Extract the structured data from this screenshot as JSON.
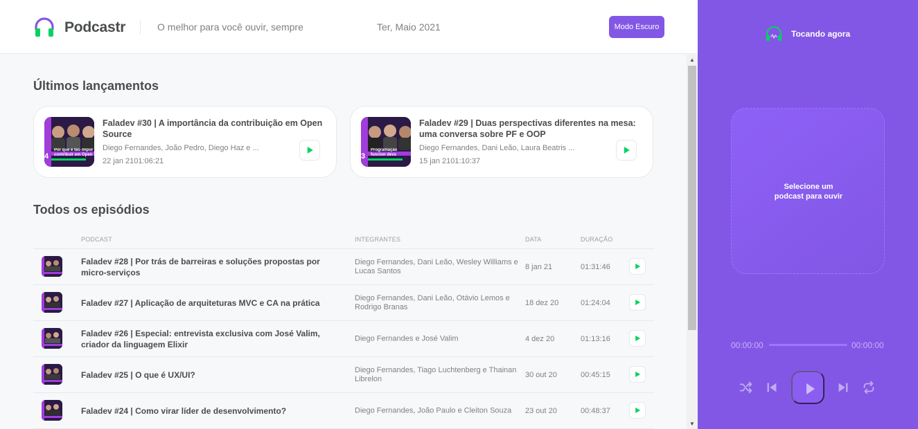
{
  "header": {
    "logo_text": "Podcastr",
    "tagline": "O melhor para você ouvir, sempre",
    "date": "Ter, Maio 2021",
    "dark_mode_label": "Modo Escuro"
  },
  "latest": {
    "title": "Últimos lançamentos",
    "episodes": [
      {
        "title": "Faladev #30 | A importância da contribuição em Open Source",
        "members": "Diego Fernandes, João Pedro, Diego Haz e ...",
        "date": "22 jan 21",
        "duration": "01:06:21",
        "date_duration": "22 jan 2101:06:21",
        "thumb_text": "Por que é tão impor contribuir em Open S",
        "thumb_number": "4"
      },
      {
        "title": "Faladev #29 | Duas perspectivas diferentes na mesa: uma conversa sobre PF e OOP",
        "members": "Diego Fernandes, Dani Leão, Laura Beatris ...",
        "date": "15 jan 21",
        "duration": "01:10:37",
        "date_duration": "15 jan 2101:10:37",
        "thumb_text": "Programação funcion devs orientados a o",
        "thumb_number": "3"
      }
    ]
  },
  "all": {
    "title": "Todos os episódios",
    "columns": {
      "podcast": "PODCAST",
      "members": "INTEGRANTES",
      "date": "DATA",
      "duration": "DURAÇÃO"
    },
    "rows": [
      {
        "title": "Faladev #28 | Por trás de barreiras e soluções propostas por micro-serviços",
        "members": "Diego Fernandes, Dani Leão, Wesley Williams e Lucas Santos",
        "date": "8 jan 21",
        "duration": "01:31:46"
      },
      {
        "title": "Faladev #27 | Aplicação de arquiteturas MVC e CA na prática",
        "members": "Diego Fernandes, Dani Leão, Otávio Lemos e Rodrigo Branas",
        "date": "18 dez 20",
        "duration": "01:24:04"
      },
      {
        "title": "Faladev #26 | Especial: entrevista exclusiva com José Valim, criador da linguagem Elixir",
        "members": "Diego Fernandes e José Valim",
        "date": "4 dez 20",
        "duration": "01:13:16"
      },
      {
        "title": "Faladev #25 | O que é UX/UI?",
        "members": "Diego Fernandes, Tiago Luchtenberg e Thainan Librelon",
        "date": "30 out 20",
        "duration": "00:45:15"
      },
      {
        "title": "Faladev #24 | Como virar líder de desenvolvimento?",
        "members": "Diego Fernandes, João Paulo e Cleiton Souza",
        "date": "23 out 20",
        "duration": "00:48:37"
      }
    ]
  },
  "player": {
    "now_playing_label": "Tocando agora",
    "empty_text_line1": "Selecione um",
    "empty_text_line2": "podcast para ouvir",
    "time_start": "00:00:00",
    "time_end": "00:00:00",
    "progress": 0
  },
  "colors": {
    "brand": "#8257e5",
    "play_green": "#04d361",
    "text": "#494d4b",
    "muted": "#808080"
  },
  "icons": {
    "logo": "headphones-icon",
    "play": "play-icon",
    "shuffle": "shuffle-icon",
    "prev": "skip-previous-icon",
    "next": "skip-next-icon",
    "repeat": "repeat-icon"
  }
}
